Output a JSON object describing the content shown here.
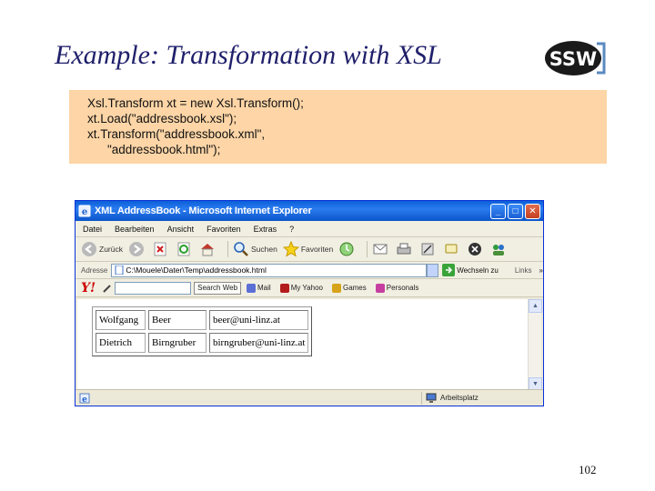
{
  "slide": {
    "title": "Example: Transformation with XSL",
    "page_number": "102",
    "logo_text": "SSW"
  },
  "code": {
    "lines": [
      "Xsl.Transform xt = new Xsl.Transform();",
      "xt.Load(\"addressbook.xsl\");",
      "xt.Transform(\"addressbook.xml\",",
      "\"addressbook.html\");"
    ]
  },
  "browser": {
    "window_title": "XML AddressBook - Microsoft Internet Explorer",
    "title_buttons": {
      "minimize": "_",
      "maximize": "□",
      "close": "✕"
    },
    "menu": [
      "Datei",
      "Bearbeiten",
      "Ansicht",
      "Favoriten",
      "Extras",
      "?"
    ],
    "toolbar": {
      "back": "Zurück",
      "search": "Suchen",
      "favorites": "Favoriten"
    },
    "address": {
      "label": "Adresse",
      "value": "C:\\Mouele\\Dater\\Temp\\addressbook.html",
      "go": "Wechseln zu",
      "links": "Links",
      "more": "»"
    },
    "yahoo_bar": {
      "logo": "Y!",
      "search_button": "Search Web",
      "items": [
        "Mail",
        "My Yahoo",
        "Games",
        "Personals"
      ]
    },
    "addressbook_rows": [
      [
        "Wolfgang",
        "Beer",
        "beer@uni-linz.at"
      ],
      [
        "Dietrich",
        "Birngruber",
        "birngruber@uni-linz.at"
      ]
    ],
    "status": {
      "zone": "Arbeitsplatz"
    }
  }
}
